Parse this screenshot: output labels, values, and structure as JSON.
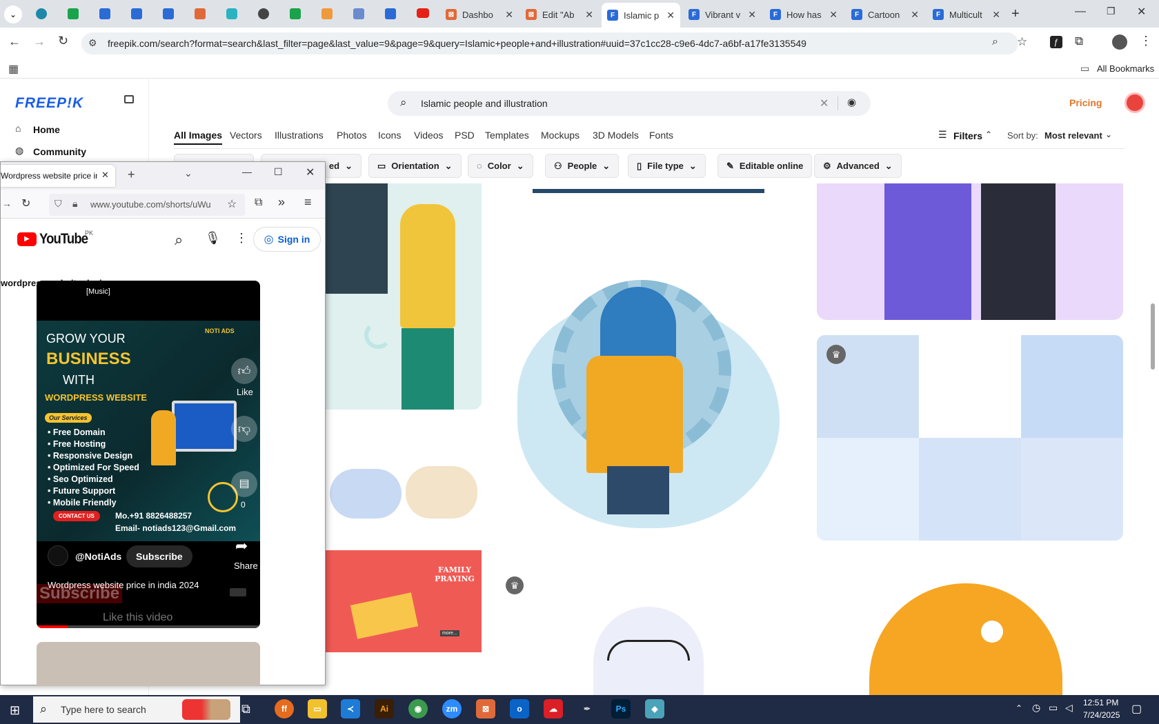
{
  "browser": {
    "tabs": [
      {
        "label": "Dashbo",
        "color": "#e0693a"
      },
      {
        "label": "Edit \"Ab",
        "color": "#e0693a"
      },
      {
        "label": "Islamic p",
        "color": "#2a6bd6",
        "active": true
      },
      {
        "label": "Vibrant v",
        "color": "#2a6bd6"
      },
      {
        "label": "How has",
        "color": "#2a6bd6"
      },
      {
        "label": "Cartoon",
        "color": "#2a6bd6"
      },
      {
        "label": "Multicult",
        "color": "#2a6bd6"
      }
    ],
    "url": "freepik.com/search?format=search&last_filter=page&last_value=9&page=9&query=Islamic+people+and+illustration#uuid=37c1cc28-c9e6-4dc7-a6bf-a17fe3135549",
    "all_bookmarks": "All Bookmarks"
  },
  "freepik": {
    "logo": "FREEP!K",
    "nav": {
      "home": "Home",
      "community": "Community"
    },
    "search_value": "Islamic people and illustration",
    "pricing": "Pricing",
    "categories": [
      "All Images",
      "Vectors",
      "Illustrations",
      "Photos",
      "Icons",
      "Videos",
      "PSD",
      "Templates",
      "Mockups",
      "3D Models",
      "Fonts"
    ],
    "filters_label": "Filters",
    "sort_label": "Sort by:",
    "sort_value": "Most relevant",
    "chips": [
      "ed",
      "Orientation",
      "Color",
      "People",
      "File type",
      "Editable online",
      "Advanced"
    ],
    "thumb_family_title": "FAMILY\nPRAYING",
    "thumb_more": "more..."
  },
  "firefox": {
    "tab_title": "Wordpress website price in",
    "url": "www.youtube.com/shorts/uWu",
    "youtube": {
      "logo": "YouTube",
      "country": "PK",
      "signin": "Sign in",
      "page_caption": "wordpress website design",
      "video": {
        "caption": "[Music]",
        "ad_brand": "NOTI ADS",
        "headline1": "GROW YOUR",
        "headline2": "BUSINESS",
        "headline3": "WITH",
        "headline4": "WORDPRESS WEBSITE",
        "services_label": "Our Services",
        "services": [
          "Free Domain",
          "Free Hosting",
          "Responsive Design",
          "Optimized For Speed",
          "Seo Optimized",
          "Future Support",
          "Mobile Friendly"
        ],
        "contact_btn": "CONTACT US",
        "phone": "Mo.+91 8826488257",
        "email": "Email- notiads123@Gmail.com",
        "like": "Like",
        "comments": "0",
        "share": "Share",
        "channel": "@NotiAds",
        "subscribe": "Subscribe",
        "title": "Wordpress website price in india 2024",
        "overlay_subscribe": "Subscribe",
        "overlay_like": "Like this video"
      }
    }
  },
  "taskbar": {
    "search_placeholder": "Type here to search",
    "time": "12:51 PM",
    "date": "7/24/2025"
  }
}
